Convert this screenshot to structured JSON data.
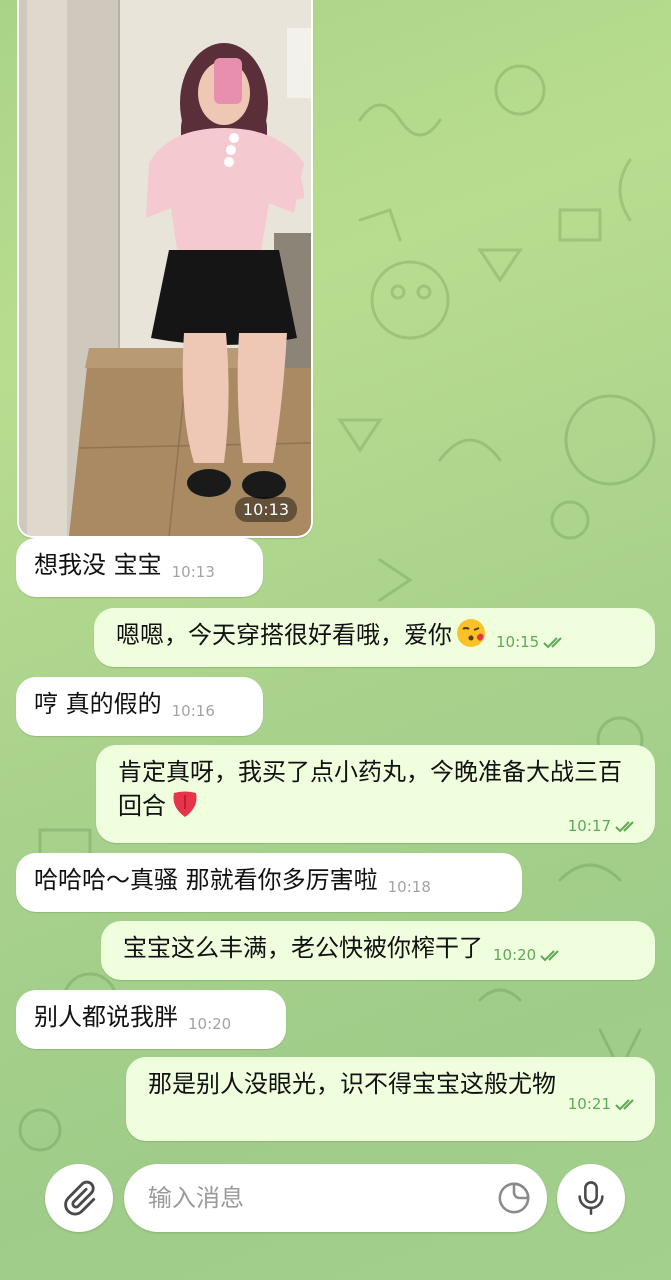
{
  "photo_message": {
    "time": "10:13"
  },
  "messages": [
    {
      "direction": "in",
      "text": "想我没 宝宝",
      "time": "10:13"
    },
    {
      "direction": "out",
      "text": "嗯嗯，今天穿搭很好看哦，爱你",
      "emoji": "kissing-face-emoji",
      "time": "10:15",
      "read": true
    },
    {
      "direction": "in",
      "text": "哼 真的假的",
      "time": "10:16"
    },
    {
      "direction": "out",
      "text": "肯定真呀，我买了点小药丸，今晚准备大战三百回合",
      "emoji": "tongue-emoji",
      "time": "10:17",
      "read": true
    },
    {
      "direction": "in",
      "text": "哈哈哈～真骚 那就看你多厉害啦",
      "time": "10:18"
    },
    {
      "direction": "out",
      "text": "宝宝这么丰满，老公快被你榨干了",
      "time": "10:20",
      "read": true
    },
    {
      "direction": "in",
      "text": "别人都说我胖",
      "time": "10:20"
    },
    {
      "direction": "out",
      "text": "那是别人没眼光，识不得宝宝这般尤物",
      "time": "10:21",
      "read": true
    }
  ],
  "composer": {
    "placeholder": "输入消息",
    "attach_icon": "paperclip-icon",
    "sticker_icon": "sticker-icon",
    "mic_icon": "microphone-icon"
  },
  "colors": {
    "incoming_bubble": "#ffffff",
    "outgoing_bubble": "#effedd",
    "outgoing_meta": "#5fa956",
    "incoming_meta": "#a3a3a3",
    "wallpaper": "#a9d487"
  }
}
